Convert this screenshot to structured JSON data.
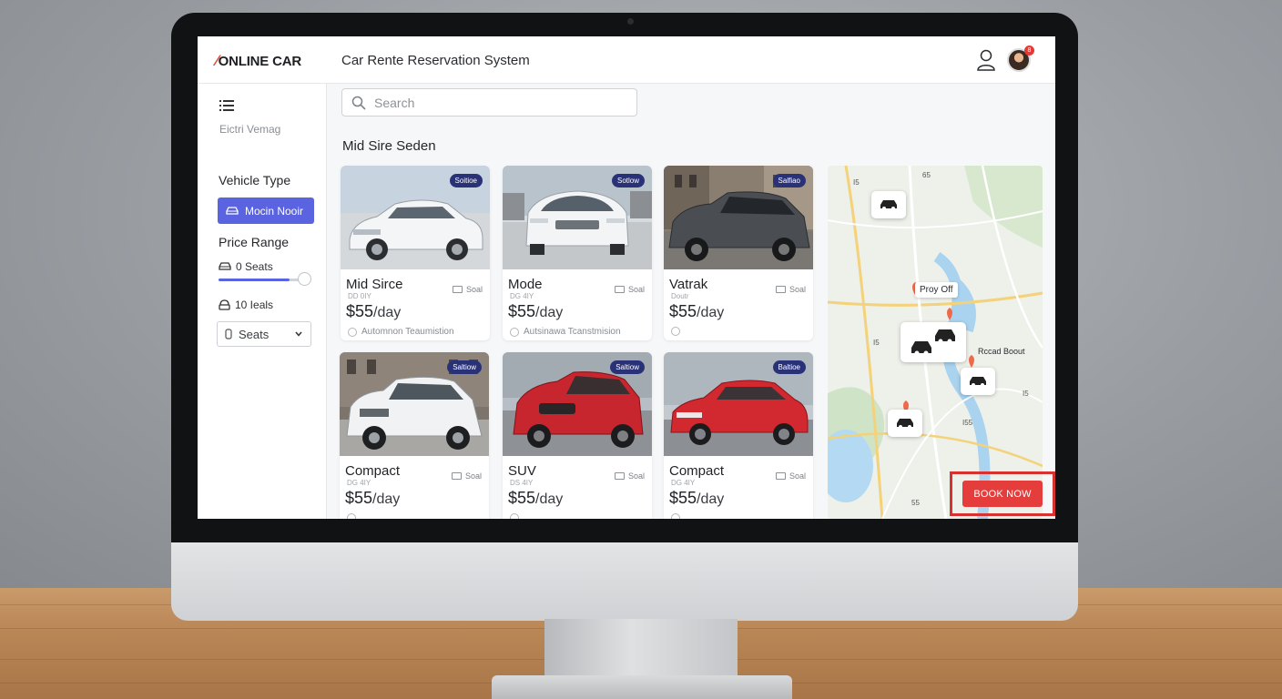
{
  "header": {
    "logo_text": "ONLINE CAR",
    "title": "Car Rente Reservation System",
    "notification_count": "8"
  },
  "sidebar": {
    "subtitle": "Eictri Vemag",
    "vehicle_type_heading": "Vehicle Type",
    "vehicle_type_selected": "Mocin Nooir",
    "price_range_heading": "Price Range",
    "price_option_1": "0 Seats",
    "price_level": 0.8,
    "price_option_2": "10 Ieals",
    "seats_select": "Seats"
  },
  "search": {
    "placeholder": "Search"
  },
  "main": {
    "section_title": "Mid Sire Seden",
    "cars": [
      {
        "name": "Mid Sirce",
        "badge": "Soitioe",
        "feature": "Soal",
        "sub": "DD 0IY",
        "price": "$55",
        "unit": "/day",
        "transmission": "Automnon Teaumistion"
      },
      {
        "name": "Mode",
        "badge": "Sotlow",
        "feature": "Soal",
        "sub": "DG 4IY",
        "price": "$55",
        "unit": "/day",
        "transmission": "Autsinawa Tcanstmision"
      },
      {
        "name": "Vatrak",
        "badge": "Salfiao",
        "feature": "Soal",
        "sub": "Doutr",
        "price": "$55",
        "unit": "/day",
        "transmission": ""
      },
      {
        "name": "Compact",
        "badge": "Saltiow",
        "feature": "Soal",
        "sub": "DG 4IY",
        "price": "$55",
        "unit": "/day",
        "transmission": ""
      },
      {
        "name": "SUV",
        "badge": "Saltiow",
        "feature": "Soal",
        "sub": "DS 4IY",
        "price": "$55",
        "unit": "/day",
        "transmission": ""
      },
      {
        "name": "Compact",
        "badge": "Baltioe",
        "feature": "Soal",
        "sub": "DG 4IY",
        "price": "$55",
        "unit": "/day",
        "transmission": ""
      }
    ]
  },
  "map": {
    "label_pickup": "Proy Off",
    "label_road": "Rccad Boout",
    "route_labels": [
      "65",
      "I5",
      "I5",
      "I5",
      "I55",
      "55"
    ],
    "book_button": "BOOK NOW"
  },
  "colors": {
    "accent": "#5a63e0",
    "logo_red": "#e8452f",
    "badge_navy": "#2a3277",
    "book_red": "#e53c3c"
  }
}
